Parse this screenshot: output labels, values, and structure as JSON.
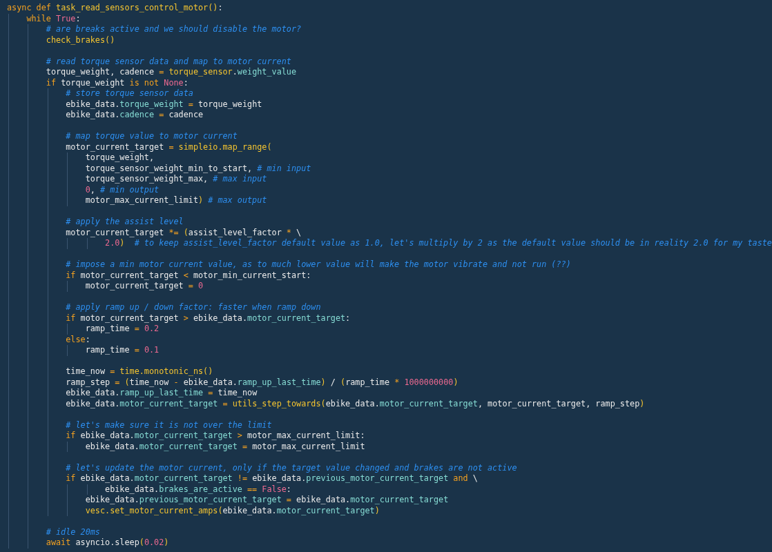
{
  "editor": {
    "lines": [
      {
        "kind": "code",
        "tokens": [
          {
            "kind": "kw",
            "text": "async def "
          },
          {
            "kind": "fn",
            "text": "task_read_sensors_control_motor()"
          },
          {
            "kind": "plain",
            "text": ":"
          }
        ],
        "children": [
          {
            "kind": "code",
            "tokens": [
              {
                "kind": "kw",
                "text": "while "
              },
              {
                "kind": "const",
                "text": "True"
              },
              {
                "kind": "plain",
                "text": ":"
              }
            ],
            "children": [
              {
                "kind": "code",
                "tokens": [
                  {
                    "kind": "comment",
                    "text": "# are breaks active and we should disable the motor?"
                  }
                ]
              },
              {
                "kind": "code",
                "tokens": [
                  {
                    "kind": "fn",
                    "text": "check_brakes()"
                  }
                ]
              },
              {
                "kind": "blank"
              },
              {
                "kind": "code",
                "tokens": [
                  {
                    "kind": "comment",
                    "text": "# read torque sensor data and map to motor current"
                  }
                ]
              },
              {
                "kind": "code",
                "tokens": [
                  {
                    "kind": "plain",
                    "text": "torque_weight, cadence "
                  },
                  {
                    "kind": "op",
                    "text": "= "
                  },
                  {
                    "kind": "fn",
                    "text": "torque_sensor"
                  },
                  {
                    "kind": "plain",
                    "text": "."
                  },
                  {
                    "kind": "attr",
                    "text": "weight_value"
                  }
                ]
              },
              {
                "kind": "code",
                "tokens": [
                  {
                    "kind": "kw",
                    "text": "if "
                  },
                  {
                    "kind": "plain",
                    "text": "torque_weight "
                  },
                  {
                    "kind": "kw",
                    "text": "is not "
                  },
                  {
                    "kind": "const",
                    "text": "None"
                  },
                  {
                    "kind": "plain",
                    "text": ":"
                  }
                ],
                "children": [
                  {
                    "kind": "code",
                    "tokens": [
                      {
                        "kind": "comment",
                        "text": "# store torque sensor data"
                      }
                    ]
                  },
                  {
                    "kind": "code",
                    "tokens": [
                      {
                        "kind": "plain",
                        "text": "ebike_data."
                      },
                      {
                        "kind": "attr",
                        "text": "torque_weight "
                      },
                      {
                        "kind": "op",
                        "text": "= "
                      },
                      {
                        "kind": "plain",
                        "text": "torque_weight"
                      }
                    ]
                  },
                  {
                    "kind": "code",
                    "tokens": [
                      {
                        "kind": "plain",
                        "text": "ebike_data."
                      },
                      {
                        "kind": "attr",
                        "text": "cadence "
                      },
                      {
                        "kind": "op",
                        "text": "= "
                      },
                      {
                        "kind": "plain",
                        "text": "cadence"
                      }
                    ]
                  },
                  {
                    "kind": "blank"
                  },
                  {
                    "kind": "code",
                    "tokens": [
                      {
                        "kind": "comment",
                        "text": "# map torque value to motor current"
                      }
                    ]
                  },
                  {
                    "kind": "code",
                    "tokens": [
                      {
                        "kind": "plain",
                        "text": "motor_current_target "
                      },
                      {
                        "kind": "op",
                        "text": "= "
                      },
                      {
                        "kind": "fn",
                        "text": "simpleio.map_range("
                      }
                    ],
                    "children": [
                      {
                        "kind": "code",
                        "tokens": [
                          {
                            "kind": "plain",
                            "text": "torque_weight,"
                          }
                        ]
                      },
                      {
                        "kind": "code",
                        "tokens": [
                          {
                            "kind": "plain",
                            "text": "torque_sensor_weight_min_to_start, "
                          },
                          {
                            "kind": "comment",
                            "text": "# min input"
                          }
                        ]
                      },
                      {
                        "kind": "code",
                        "tokens": [
                          {
                            "kind": "plain",
                            "text": "torque_sensor_weight_max, "
                          },
                          {
                            "kind": "comment",
                            "text": "# max input"
                          }
                        ]
                      },
                      {
                        "kind": "code",
                        "tokens": [
                          {
                            "kind": "const",
                            "text": "0"
                          },
                          {
                            "kind": "plain",
                            "text": ", "
                          },
                          {
                            "kind": "comment",
                            "text": "# min output"
                          }
                        ]
                      },
                      {
                        "kind": "code",
                        "tokens": [
                          {
                            "kind": "plain",
                            "text": "motor_max_current_limit"
                          },
                          {
                            "kind": "fn",
                            "text": ") "
                          },
                          {
                            "kind": "comment",
                            "text": "# max output"
                          }
                        ]
                      }
                    ]
                  },
                  {
                    "kind": "blank"
                  },
                  {
                    "kind": "code",
                    "tokens": [
                      {
                        "kind": "comment",
                        "text": "# apply the assist level"
                      }
                    ]
                  },
                  {
                    "kind": "code",
                    "tokens": [
                      {
                        "kind": "plain",
                        "text": "motor_current_target "
                      },
                      {
                        "kind": "op",
                        "text": "*= "
                      },
                      {
                        "kind": "fn",
                        "text": "("
                      },
                      {
                        "kind": "plain",
                        "text": "assist_level_factor "
                      },
                      {
                        "kind": "op",
                        "text": "* "
                      },
                      {
                        "kind": "plain",
                        "text": "\\"
                      }
                    ],
                    "children": [
                      {
                        "kind": "continuation",
                        "tokens": [
                          {
                            "kind": "const",
                            "text": "2.0"
                          },
                          {
                            "kind": "fn",
                            "text": ")  "
                          },
                          {
                            "kind": "comment",
                            "text": "# to keep assist_level_factor default value as 1.0, let's multiply by 2 as the default value should be in reality 2.0 for my taste"
                          }
                        ]
                      }
                    ]
                  },
                  {
                    "kind": "blank"
                  },
                  {
                    "kind": "code",
                    "tokens": [
                      {
                        "kind": "comment",
                        "text": "# impose a min motor current value, as to much lower value will make the motor vibrate and not run (??)"
                      }
                    ]
                  },
                  {
                    "kind": "code",
                    "tokens": [
                      {
                        "kind": "kw",
                        "text": "if "
                      },
                      {
                        "kind": "plain",
                        "text": "motor_current_target "
                      },
                      {
                        "kind": "op",
                        "text": "< "
                      },
                      {
                        "kind": "plain",
                        "text": "motor_min_current_start:"
                      }
                    ],
                    "children": [
                      {
                        "kind": "code",
                        "tokens": [
                          {
                            "kind": "plain",
                            "text": "motor_current_target "
                          },
                          {
                            "kind": "op",
                            "text": "= "
                          },
                          {
                            "kind": "const",
                            "text": "0"
                          }
                        ]
                      }
                    ]
                  },
                  {
                    "kind": "blank"
                  },
                  {
                    "kind": "code",
                    "tokens": [
                      {
                        "kind": "comment",
                        "text": "# apply ramp up / down factor: faster when ramp down"
                      }
                    ]
                  },
                  {
                    "kind": "code",
                    "tokens": [
                      {
                        "kind": "kw",
                        "text": "if "
                      },
                      {
                        "kind": "plain",
                        "text": "motor_current_target "
                      },
                      {
                        "kind": "op",
                        "text": "> "
                      },
                      {
                        "kind": "plain",
                        "text": "ebike_data."
                      },
                      {
                        "kind": "attr",
                        "text": "motor_current_target"
                      },
                      {
                        "kind": "plain",
                        "text": ":"
                      }
                    ],
                    "children": [
                      {
                        "kind": "code",
                        "tokens": [
                          {
                            "kind": "plain",
                            "text": "ramp_time "
                          },
                          {
                            "kind": "op",
                            "text": "= "
                          },
                          {
                            "kind": "const",
                            "text": "0.2"
                          }
                        ]
                      }
                    ]
                  },
                  {
                    "kind": "code",
                    "tokens": [
                      {
                        "kind": "kw",
                        "text": "else"
                      },
                      {
                        "kind": "plain",
                        "text": ":"
                      }
                    ],
                    "children": [
                      {
                        "kind": "code",
                        "tokens": [
                          {
                            "kind": "plain",
                            "text": "ramp_time "
                          },
                          {
                            "kind": "op",
                            "text": "= "
                          },
                          {
                            "kind": "const",
                            "text": "0.1"
                          }
                        ]
                      }
                    ]
                  },
                  {
                    "kind": "blank"
                  },
                  {
                    "kind": "code",
                    "tokens": [
                      {
                        "kind": "plain",
                        "text": "time_now "
                      },
                      {
                        "kind": "op",
                        "text": "= "
                      },
                      {
                        "kind": "fn",
                        "text": "time.monotonic_ns()"
                      }
                    ]
                  },
                  {
                    "kind": "code",
                    "tokens": [
                      {
                        "kind": "plain",
                        "text": "ramp_step "
                      },
                      {
                        "kind": "op",
                        "text": "= "
                      },
                      {
                        "kind": "fn",
                        "text": "("
                      },
                      {
                        "kind": "plain",
                        "text": "time_now "
                      },
                      {
                        "kind": "op",
                        "text": "- "
                      },
                      {
                        "kind": "plain",
                        "text": "ebike_data."
                      },
                      {
                        "kind": "attr",
                        "text": "ramp_up_last_time"
                      },
                      {
                        "kind": "fn",
                        "text": ")"
                      },
                      {
                        "kind": "plain",
                        "text": " / "
                      },
                      {
                        "kind": "fn",
                        "text": "("
                      },
                      {
                        "kind": "plain",
                        "text": "ramp_time "
                      },
                      {
                        "kind": "op",
                        "text": "* "
                      },
                      {
                        "kind": "const",
                        "text": "1000000000"
                      },
                      {
                        "kind": "fn",
                        "text": ")"
                      }
                    ]
                  },
                  {
                    "kind": "code",
                    "tokens": [
                      {
                        "kind": "plain",
                        "text": "ebike_data."
                      },
                      {
                        "kind": "attr",
                        "text": "ramp_up_last_time "
                      },
                      {
                        "kind": "op",
                        "text": "= "
                      },
                      {
                        "kind": "plain",
                        "text": "time_now"
                      }
                    ]
                  },
                  {
                    "kind": "code",
                    "tokens": [
                      {
                        "kind": "plain",
                        "text": "ebike_data."
                      },
                      {
                        "kind": "attr",
                        "text": "motor_current_target "
                      },
                      {
                        "kind": "op",
                        "text": "= "
                      },
                      {
                        "kind": "fn",
                        "text": "utils_step_towards("
                      },
                      {
                        "kind": "plain",
                        "text": "ebike_data."
                      },
                      {
                        "kind": "attr",
                        "text": "motor_current_target"
                      },
                      {
                        "kind": "plain",
                        "text": ", motor_current_target, ramp_step"
                      },
                      {
                        "kind": "fn",
                        "text": ")"
                      }
                    ]
                  },
                  {
                    "kind": "blank"
                  },
                  {
                    "kind": "code",
                    "tokens": [
                      {
                        "kind": "comment",
                        "text": "# let's make sure it is not over the limit"
                      }
                    ]
                  },
                  {
                    "kind": "code",
                    "tokens": [
                      {
                        "kind": "kw",
                        "text": "if "
                      },
                      {
                        "kind": "plain",
                        "text": "ebike_data."
                      },
                      {
                        "kind": "attr",
                        "text": "motor_current_target "
                      },
                      {
                        "kind": "op",
                        "text": "> "
                      },
                      {
                        "kind": "plain",
                        "text": "motor_max_current_limit:"
                      }
                    ],
                    "children": [
                      {
                        "kind": "code",
                        "tokens": [
                          {
                            "kind": "plain",
                            "text": "ebike_data."
                          },
                          {
                            "kind": "attr",
                            "text": "motor_current_target "
                          },
                          {
                            "kind": "op",
                            "text": "= "
                          },
                          {
                            "kind": "plain",
                            "text": "motor_max_current_limit"
                          }
                        ]
                      }
                    ]
                  },
                  {
                    "kind": "blank"
                  },
                  {
                    "kind": "code",
                    "tokens": [
                      {
                        "kind": "comment",
                        "text": "# let's update the motor current, only if the target value changed and brakes are not active"
                      }
                    ]
                  },
                  {
                    "kind": "code",
                    "tokens": [
                      {
                        "kind": "kw",
                        "text": "if "
                      },
                      {
                        "kind": "plain",
                        "text": "ebike_data."
                      },
                      {
                        "kind": "attr",
                        "text": "motor_current_target "
                      },
                      {
                        "kind": "op",
                        "text": "!= "
                      },
                      {
                        "kind": "plain",
                        "text": "ebike_data."
                      },
                      {
                        "kind": "attr",
                        "text": "previous_motor_current_target "
                      },
                      {
                        "kind": "kw",
                        "text": "and "
                      },
                      {
                        "kind": "plain",
                        "text": "\\"
                      }
                    ],
                    "children": [
                      {
                        "kind": "continuation",
                        "tokens": [
                          {
                            "kind": "plain",
                            "text": "ebike_data."
                          },
                          {
                            "kind": "attr",
                            "text": "brakes_are_active "
                          },
                          {
                            "kind": "op",
                            "text": "== "
                          },
                          {
                            "kind": "const",
                            "text": "False"
                          },
                          {
                            "kind": "plain",
                            "text": ":"
                          }
                        ]
                      },
                      {
                        "kind": "code",
                        "tokens": [
                          {
                            "kind": "plain",
                            "text": "ebike_data."
                          },
                          {
                            "kind": "attr",
                            "text": "previous_motor_current_target "
                          },
                          {
                            "kind": "op",
                            "text": "= "
                          },
                          {
                            "kind": "plain",
                            "text": "ebike_data."
                          },
                          {
                            "kind": "attr",
                            "text": "motor_current_target"
                          }
                        ]
                      },
                      {
                        "kind": "code",
                        "tokens": [
                          {
                            "kind": "fn",
                            "text": "vesc.set_motor_current_amps("
                          },
                          {
                            "kind": "plain",
                            "text": "ebike_data."
                          },
                          {
                            "kind": "attr",
                            "text": "motor_current_target"
                          },
                          {
                            "kind": "fn",
                            "text": ")"
                          }
                        ]
                      }
                    ]
                  }
                ]
              },
              {
                "kind": "blank"
              },
              {
                "kind": "code",
                "tokens": [
                  {
                    "kind": "comment",
                    "text": "# idle 20ms"
                  }
                ]
              },
              {
                "kind": "code",
                "tokens": [
                  {
                    "kind": "kw",
                    "text": "await "
                  },
                  {
                    "kind": "plain",
                    "text": "asyncio.sleep"
                  },
                  {
                    "kind": "fn",
                    "text": "("
                  },
                  {
                    "kind": "const",
                    "text": "0.02"
                  },
                  {
                    "kind": "fn",
                    "text": ")"
                  }
                ]
              }
            ]
          }
        ]
      }
    ]
  }
}
